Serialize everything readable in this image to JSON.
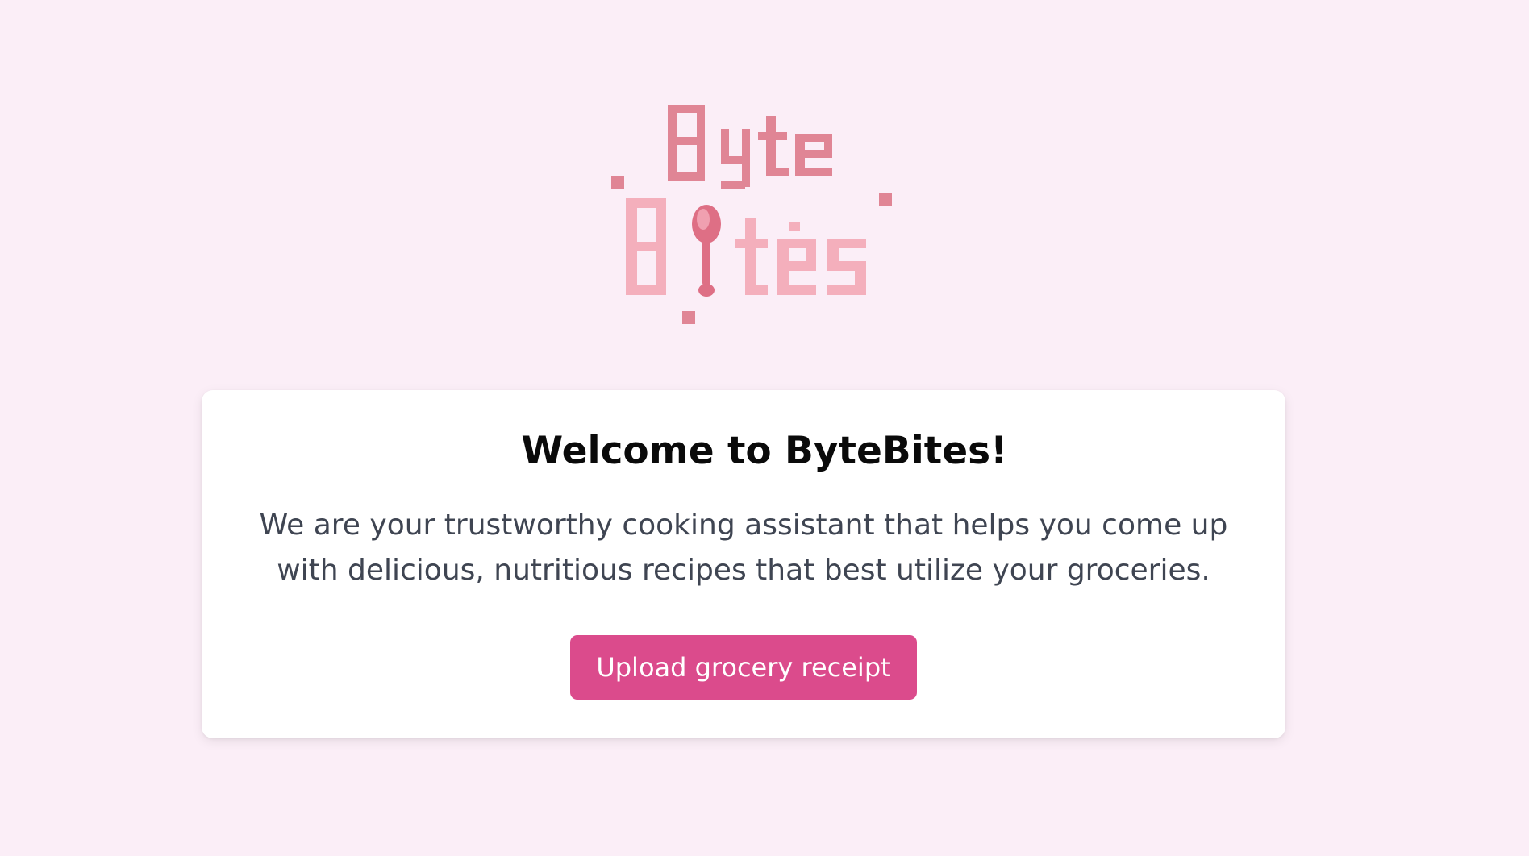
{
  "logo": {
    "text_line1": "Byte",
    "text_line2": "Bites",
    "colors": {
      "dark_pink": "#e08595",
      "light_pink": "#f4afbc",
      "spoon": "#de6f85"
    },
    "icon": "spoon-icon"
  },
  "welcome": {
    "title": "Welcome to ByteBites!",
    "description": "We are your trustworthy cooking assistant that helps you come up with delicious, nutritious recipes that best utilize your groceries.",
    "upload_button_label": "Upload grocery receipt"
  },
  "colors": {
    "background": "#fbeef7",
    "card": "#ffffff",
    "button": "#db4b8c",
    "title_text": "#0a0a0a",
    "body_text": "#3f4552"
  }
}
